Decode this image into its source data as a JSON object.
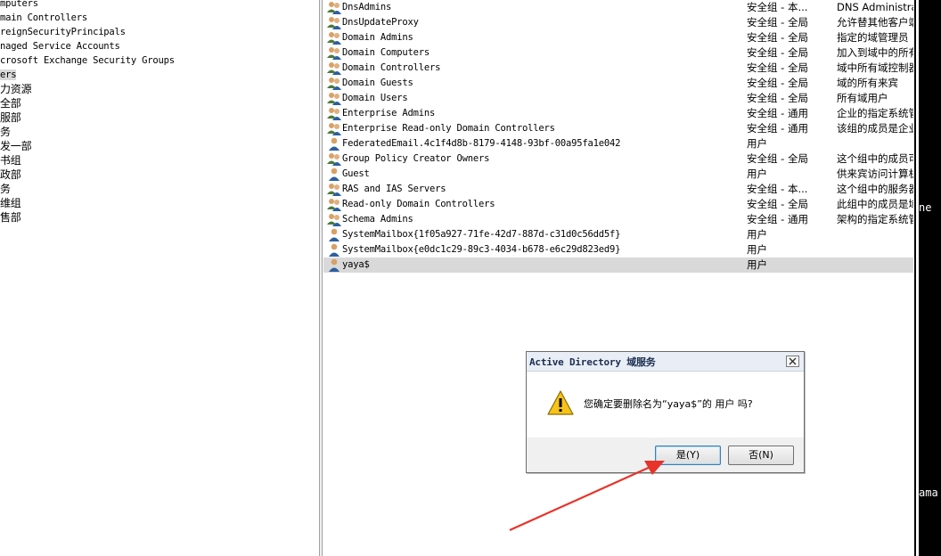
{
  "tree": {
    "items": [
      {
        "label": "mputers",
        "cjk": false,
        "selected": false
      },
      {
        "label": "main Controllers",
        "cjk": false,
        "selected": false
      },
      {
        "label": "reignSecurityPrincipals",
        "cjk": false,
        "selected": false
      },
      {
        "label": "naged Service Accounts",
        "cjk": false,
        "selected": false
      },
      {
        "label": "crosoft Exchange Security Groups",
        "cjk": false,
        "selected": false
      },
      {
        "label": "ers",
        "cjk": false,
        "selected": true
      },
      {
        "label": "力资源",
        "cjk": true,
        "selected": false
      },
      {
        "label": "全部",
        "cjk": true,
        "selected": false
      },
      {
        "label": "服部",
        "cjk": true,
        "selected": false
      },
      {
        "label": "务",
        "cjk": true,
        "selected": false
      },
      {
        "label": "发一部",
        "cjk": true,
        "selected": false
      },
      {
        "label": "书组",
        "cjk": true,
        "selected": false
      },
      {
        "label": "政部",
        "cjk": true,
        "selected": false
      },
      {
        "label": "务",
        "cjk": true,
        "selected": false
      },
      {
        "label": "维组",
        "cjk": true,
        "selected": false
      },
      {
        "label": "售部",
        "cjk": true,
        "selected": false
      }
    ]
  },
  "list": {
    "rows": [
      {
        "name": "DnsAdmins",
        "type": "安全组 - 本...",
        "desc": "DNS Administra",
        "icon": "group-icon",
        "selected": false
      },
      {
        "name": "DnsUpdateProxy",
        "type": "安全组 - 全局",
        "desc": "允许替其他客户端",
        "icon": "group-icon",
        "selected": false
      },
      {
        "name": "Domain Admins",
        "type": "安全组 - 全局",
        "desc": "指定的域管理员",
        "icon": "group-icon",
        "selected": false
      },
      {
        "name": "Domain Computers",
        "type": "安全组 - 全局",
        "desc": "加入到域中的所有",
        "icon": "group-icon",
        "selected": false
      },
      {
        "name": "Domain Controllers",
        "type": "安全组 - 全局",
        "desc": "域中所有域控制器",
        "icon": "group-icon",
        "selected": false
      },
      {
        "name": "Domain Guests",
        "type": "安全组 - 全局",
        "desc": "域的所有来宾",
        "icon": "group-icon",
        "selected": false
      },
      {
        "name": "Domain Users",
        "type": "安全组 - 全局",
        "desc": "所有域用户",
        "icon": "group-icon",
        "selected": false
      },
      {
        "name": "Enterprise Admins",
        "type": "安全组 - 通用",
        "desc": "企业的指定系统管",
        "icon": "group-icon",
        "selected": false
      },
      {
        "name": "Enterprise Read-only Domain Controllers",
        "type": "安全组 - 通用",
        "desc": "该组的成员是企业",
        "icon": "group-icon",
        "selected": false
      },
      {
        "name": "FederatedEmail.4c1f4d8b-8179-4148-93bf-00a95fa1e042",
        "type": "用户",
        "desc": "",
        "icon": "user-icon",
        "selected": false
      },
      {
        "name": "Group Policy Creator Owners",
        "type": "安全组 - 全局",
        "desc": "这个组中的成员可",
        "icon": "group-icon",
        "selected": false
      },
      {
        "name": "Guest",
        "type": "用户",
        "desc": "供来宾访问计算机",
        "icon": "user-icon",
        "selected": false
      },
      {
        "name": "RAS and IAS Servers",
        "type": "安全组 - 本...",
        "desc": "这个组中的服务器",
        "icon": "group-icon",
        "selected": false
      },
      {
        "name": "Read-only Domain Controllers",
        "type": "安全组 - 全局",
        "desc": "此组中的成员是域",
        "icon": "group-icon",
        "selected": false
      },
      {
        "name": "Schema Admins",
        "type": "安全组 - 通用",
        "desc": "架构的指定系统管",
        "icon": "group-icon",
        "selected": false
      },
      {
        "name": "SystemMailbox{1f05a927-71fe-42d7-887d-c31d0c56dd5f}",
        "type": "用户",
        "desc": "",
        "icon": "user-icon",
        "selected": false
      },
      {
        "name": "SystemMailbox{e0dc1c29-89c3-4034-b678-e6c29d823ed9}",
        "type": "用户",
        "desc": "",
        "icon": "user-icon",
        "selected": false
      },
      {
        "name": "yaya$",
        "type": "用户",
        "desc": "",
        "icon": "user-icon",
        "selected": true
      }
    ]
  },
  "strip": {
    "text_top": "ne",
    "text_bottom": "ama"
  },
  "dialog": {
    "title_latin": "Active Directory ",
    "title_cjk": "域服务",
    "message": "您确定要删除名为“yaya$”的 用户 吗?",
    "yes_label": "是(Y)",
    "no_label": "否(N)",
    "warning_icon": "warning-icon",
    "close_icon": "close-icon"
  },
  "colors": {
    "selected_row": "#d9d9d9",
    "arrow": "#e8332a",
    "dialog_title_bg": "#e9eef6",
    "warning": "#f6c31a"
  }
}
